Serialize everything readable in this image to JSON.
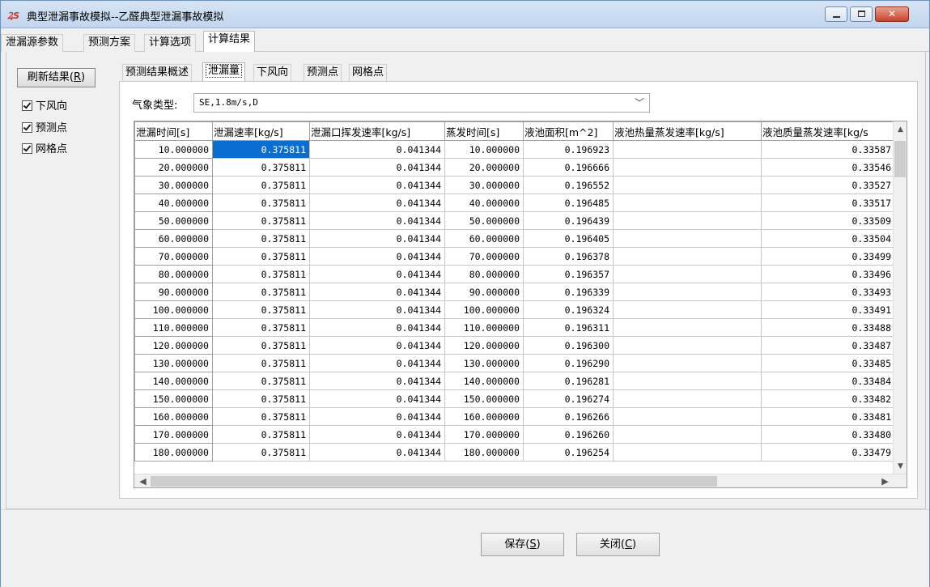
{
  "window": {
    "title": "典型泄漏事故模拟--乙醛典型泄漏事故模拟",
    "icon": "app-logo-icon",
    "icon_text": "ꝜS"
  },
  "outer_tabs": [
    {
      "label": "泄漏源参数"
    },
    {
      "label": "预测方案"
    },
    {
      "label": "计算选项"
    },
    {
      "label": "计算结果"
    }
  ],
  "left_panel": {
    "refresh_label": "刷新结果(R)",
    "refresh_text": "刷新结果(",
    "refresh_key": "R",
    "checkboxes": [
      {
        "label": "下风向",
        "checked": true
      },
      {
        "label": "预测点",
        "checked": true
      },
      {
        "label": "网格点",
        "checked": true
      }
    ]
  },
  "inner_tabs": [
    {
      "label": "预测结果概述"
    },
    {
      "label": "泄漏量"
    },
    {
      "label": "下风向"
    },
    {
      "label": "预测点"
    },
    {
      "label": "网格点"
    }
  ],
  "weather": {
    "label": "气象类型:",
    "value": "SE,1.8m/s,D"
  },
  "table": {
    "columns": [
      "泄漏时间[s]",
      "泄漏速率[kg/s]",
      "泄漏口挥发速率[kg/s]",
      "蒸发时间[s]",
      "液池面积[m^2]",
      "液池热量蒸发速率[kg/s]",
      "液池质量蒸发速率[kg/s"
    ],
    "rows": [
      [
        "10.000000",
        "0.375811",
        "0.041344",
        "10.000000",
        "0.196923",
        "",
        "0.33587"
      ],
      [
        "20.000000",
        "0.375811",
        "0.041344",
        "20.000000",
        "0.196666",
        "",
        "0.33546"
      ],
      [
        "30.000000",
        "0.375811",
        "0.041344",
        "30.000000",
        "0.196552",
        "",
        "0.33527"
      ],
      [
        "40.000000",
        "0.375811",
        "0.041344",
        "40.000000",
        "0.196485",
        "",
        "0.33517"
      ],
      [
        "50.000000",
        "0.375811",
        "0.041344",
        "50.000000",
        "0.196439",
        "",
        "0.33509"
      ],
      [
        "60.000000",
        "0.375811",
        "0.041344",
        "60.000000",
        "0.196405",
        "",
        "0.33504"
      ],
      [
        "70.000000",
        "0.375811",
        "0.041344",
        "70.000000",
        "0.196378",
        "",
        "0.33499"
      ],
      [
        "80.000000",
        "0.375811",
        "0.041344",
        "80.000000",
        "0.196357",
        "",
        "0.33496"
      ],
      [
        "90.000000",
        "0.375811",
        "0.041344",
        "90.000000",
        "0.196339",
        "",
        "0.33493"
      ],
      [
        "100.000000",
        "0.375811",
        "0.041344",
        "100.000000",
        "0.196324",
        "",
        "0.33491"
      ],
      [
        "110.000000",
        "0.375811",
        "0.041344",
        "110.000000",
        "0.196311",
        "",
        "0.33488"
      ],
      [
        "120.000000",
        "0.375811",
        "0.041344",
        "120.000000",
        "0.196300",
        "",
        "0.33487"
      ],
      [
        "130.000000",
        "0.375811",
        "0.041344",
        "130.000000",
        "0.196290",
        "",
        "0.33485"
      ],
      [
        "140.000000",
        "0.375811",
        "0.041344",
        "140.000000",
        "0.196281",
        "",
        "0.33484"
      ],
      [
        "150.000000",
        "0.375811",
        "0.041344",
        "150.000000",
        "0.196274",
        "",
        "0.33482"
      ],
      [
        "160.000000",
        "0.375811",
        "0.041344",
        "160.000000",
        "0.196266",
        "",
        "0.33481"
      ],
      [
        "170.000000",
        "0.375811",
        "0.041344",
        "170.000000",
        "0.196260",
        "",
        "0.33480"
      ],
      [
        "180.000000",
        "0.375811",
        "0.041344",
        "180.000000",
        "0.196254",
        "",
        "0.33479"
      ]
    ],
    "selected_cell": {
      "row": 0,
      "col": 1
    }
  },
  "buttons": {
    "save_text": "保存(",
    "save_key": "S",
    "close_text": "关闭(",
    "close_key": "C",
    "paren_close": ")"
  },
  "colors": {
    "selection": "#0a6ed1",
    "close_button": "#c7432b"
  }
}
